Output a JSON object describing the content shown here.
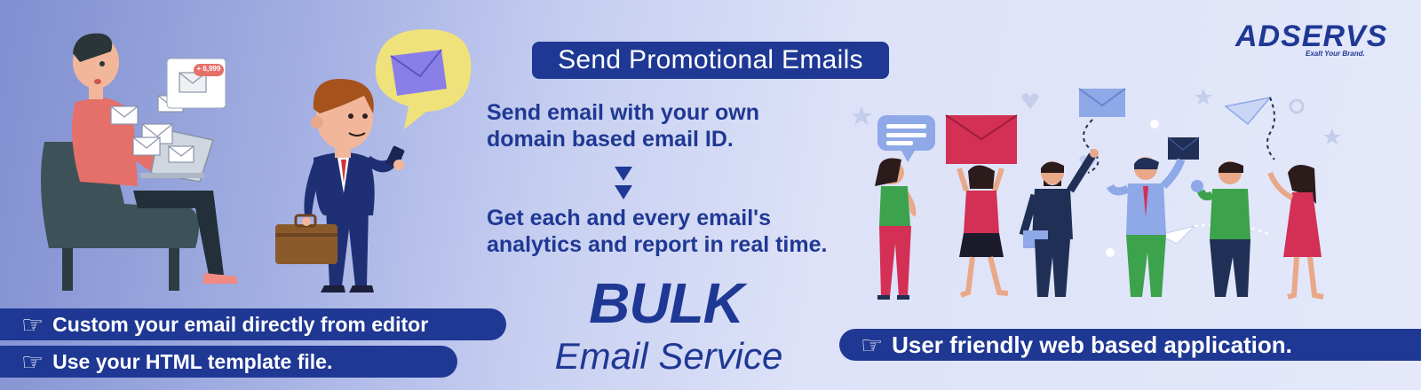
{
  "headline": "Send Promotional Emails",
  "feature_line_1": [
    "Send email with your own",
    "domain based email ID."
  ],
  "feature_line_2": [
    "Get each and every email's",
    "analytics and report in real time."
  ],
  "title": {
    "line1": "BULK",
    "line2": "Email Service"
  },
  "pills": [
    "Custom your email directly from editor",
    "Use your HTML template file.",
    "User friendly web based application."
  ],
  "notification_badge": "+ 6,999",
  "logo": {
    "name": "ADSERVS",
    "tagline": "Exalt Your Brand."
  },
  "colors": {
    "brand": "#1f3894",
    "accent_red": "#e0324e",
    "bubble_yellow": "#efe27a",
    "envelope_purple": "#8a7fe6"
  },
  "icons": [
    "pointing-hand-icon",
    "envelope-icon",
    "chat-bubble-icon",
    "paper-plane-icon"
  ]
}
